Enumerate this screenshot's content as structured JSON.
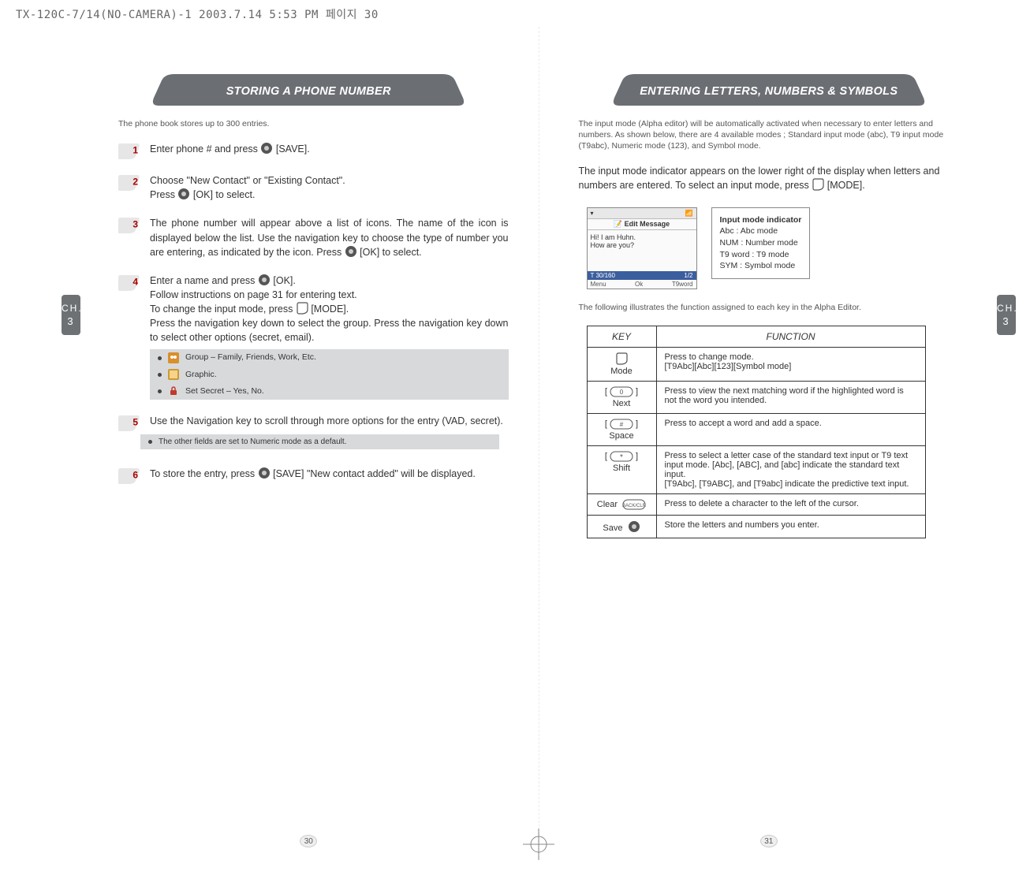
{
  "topstamp": "TX-120C-7/14(NO-CAMERA)-1  2003.7.14 5:53 PM 페이지 30",
  "left": {
    "banner": "STORING A PHONE NUMBER",
    "intro": "The phone book stores up to 300 entries.",
    "steps": [
      {
        "n": "1",
        "pre": "Enter phone # and press ",
        "after": " [SAVE]."
      },
      {
        "n": "2",
        "line1": "Choose \"New Contact\" or \"Existing Contact\".",
        "line2_pre": "Press ",
        "line2_after": " [OK] to select."
      },
      {
        "n": "3",
        "body": "The phone number will appear above a list of icons. The name of the icon is displayed below the list. Use the navigation key to choose the type of number you are entering, as indicated by the icon. Press ",
        "after": " [OK] to select."
      },
      {
        "n": "4",
        "l1_pre": "Enter a name and press ",
        "l1_after": " [OK].",
        "l2": "Follow instructions on page 31 for entering text.",
        "l3_pre": "To change the input mode, press ",
        "l3_after": " [MODE].",
        "l4": "Press the navigation key down to select the group.  Press the navigation key down to select other options (secret, email).",
        "notes": [
          "Group – Family, Friends, Work, Etc.",
          "Graphic.",
          "Set Secret – Yes, No."
        ]
      },
      {
        "n": "5",
        "body": "Use the Navigation key to scroll through more options for the entry (VAD, secret).",
        "notebar": "The other fields are set to Numeric mode as a default."
      },
      {
        "n": "6",
        "pre": "To store the entry, press ",
        "after": " [SAVE] \"New contact added\" will be displayed."
      }
    ],
    "ch": {
      "label": "CH.",
      "num": "3"
    },
    "pagenum": "30"
  },
  "right": {
    "banner": "ENTERING LETTERS, NUMBERS & SYMBOLS",
    "intro": "The input mode (Alpha editor) will be automatically activated when necessary to enter letters and numbers. As shown below, there are 4 available modes ; Standard input mode (abc), T9 input mode (T9abc), Numeric mode (123), and Symbol mode.",
    "statement_pre": "The input mode indicator appears on the lower right of the display when letters and numbers are entered.  To select an input mode, press ",
    "statement_after": " [MODE].",
    "screen": {
      "status_left": "▾",
      "status_right": "📶",
      "title": "Edit Message",
      "body_l1": "Hi! I am Huhn.",
      "body_l2": "How are you?",
      "stat_left": "T 30/160",
      "stat_right": "1/2",
      "soft_l": "Menu",
      "soft_m": "Ok",
      "soft_r": "T9word"
    },
    "callout": {
      "title": "Input mode indicator",
      "l1": "Abc : Abc mode",
      "l2": "NUM : Number mode",
      "l3": "T9 word : T9 mode",
      "l4": "SYM : Symbol mode"
    },
    "table_intro": "The following illustrates the function assigned to each key in the Alpha Editor.",
    "headers": {
      "key": "KEY",
      "func": "FUNCTION"
    },
    "rows": [
      {
        "keylabel": "Mode",
        "glyph": "soft",
        "func": "Press to change mode.\n[T9Abc][Abc][123][Symbol mode]"
      },
      {
        "keylabel": "Next",
        "glyph": "keycap0",
        "func": "Press to view the next matching word if the highlighted word is not the word you intended."
      },
      {
        "keylabel": "Space",
        "glyph": "keycapHash",
        "func": "Press to accept a word and add a space."
      },
      {
        "keylabel": "Shift",
        "glyph": "keycapStar",
        "func": "Press to select a letter case of the standard text input or T9  text input mode. [Abc], [ABC], and [abc] indicate the standard text input.\n[T9Abc], [T9ABC], and [T9abc] indicate the predictive text input."
      },
      {
        "keylabel": "Clear",
        "glyph": "clr",
        "func": "Press to delete a character to the left of the cursor."
      },
      {
        "keylabel": "Save",
        "glyph": "ok",
        "func": "Store the letters and numbers you enter."
      }
    ],
    "ch": {
      "label": "CH.",
      "num": "3"
    },
    "pagenum": "31"
  }
}
